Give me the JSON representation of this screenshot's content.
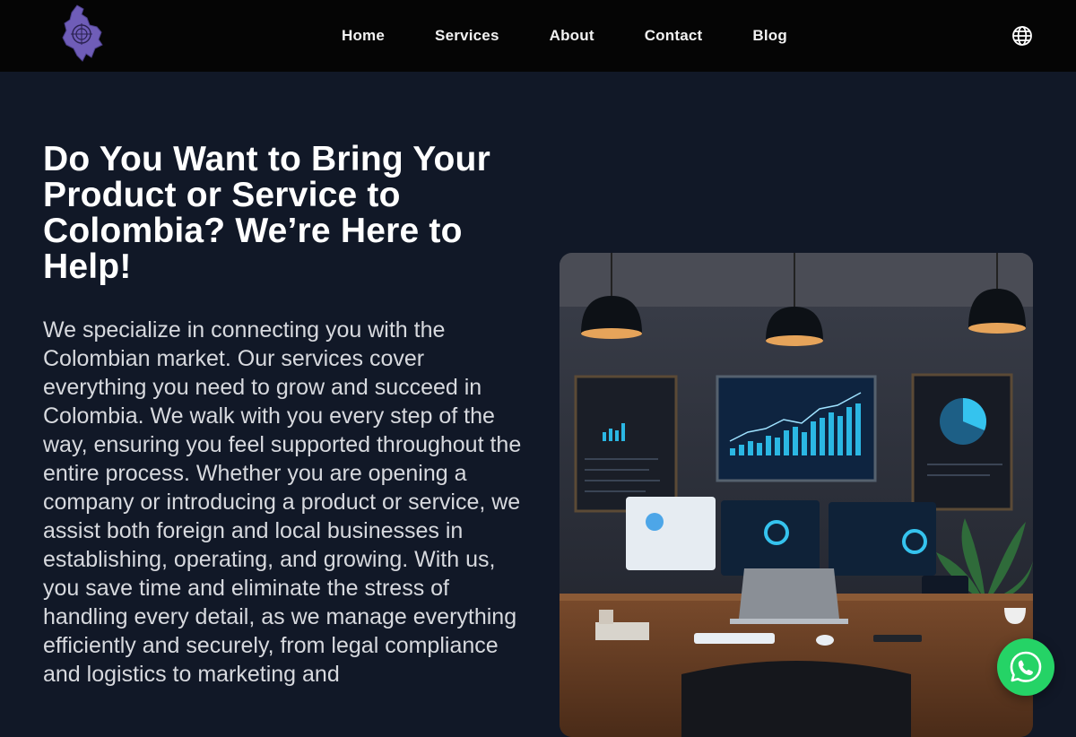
{
  "header": {
    "nav": [
      "Home",
      "Services",
      "About",
      "Contact",
      "Blog"
    ],
    "language_icon": "globe-icon",
    "logo_icon": "colombia-map-logo",
    "logo_color": "#6f5db8"
  },
  "hero": {
    "title": "Do You Want to Bring Your Product or Service to Colombia? We’re Here to Help!",
    "body": "We specialize in connecting you with the Colombian market. Our services cover everything you need to grow and succeed in Colombia. We walk with you every step of the way, ensuring you feel supported throughout the entire process. Whether you are opening a company or introducing a product or service, we assist both foreign and local businesses in establishing, operating, and growing. With us, you save time and eliminate the stress of handling every detail, as we manage everything efficiently and securely, from legal compliance and logistics to marketing and"
  },
  "floating": {
    "whatsapp_icon": "whatsapp-icon",
    "whatsapp_color": "#25d366"
  },
  "colors": {
    "page_background": "#111827",
    "header_background": "#050505",
    "accent_cyan": "#22b8d8"
  }
}
